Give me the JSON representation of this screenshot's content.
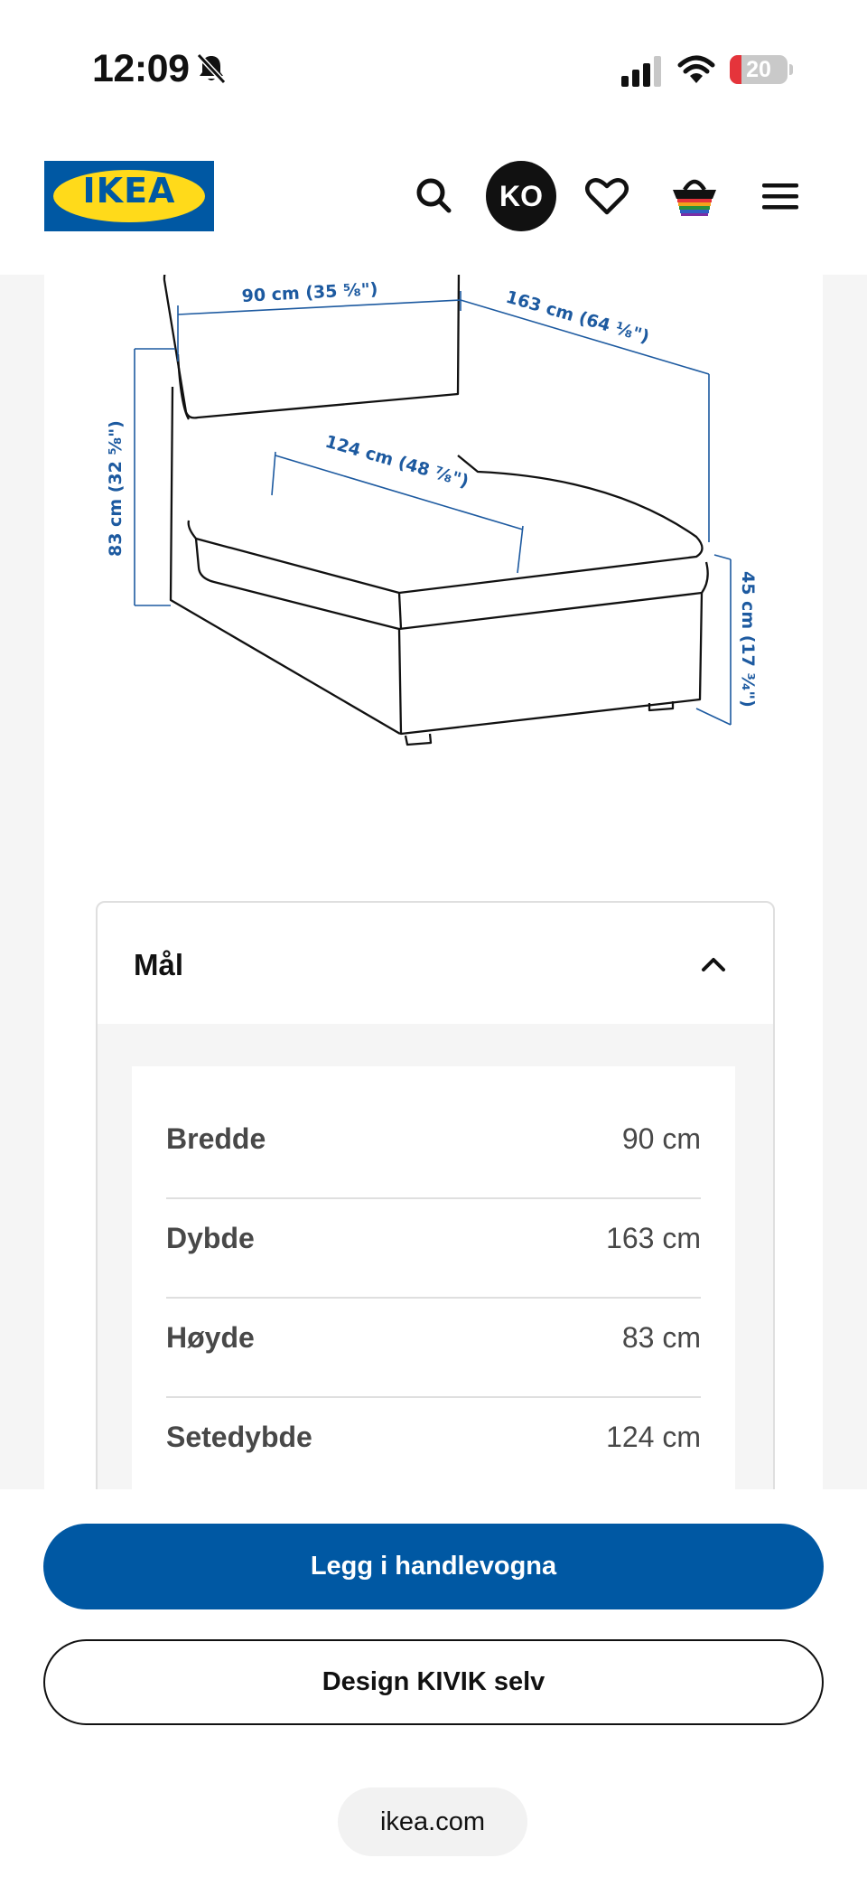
{
  "status_bar": {
    "time": "12:09",
    "battery_level": "20",
    "battery_fraction": 0.2,
    "battery_color": "#e5343b"
  },
  "header": {
    "logo_text": "IKEA",
    "logo_colors": {
      "blue": "#0058a3",
      "yellow": "#ffda1a"
    },
    "avatar_initials": "KO",
    "icons": [
      "search-icon",
      "heart-icon",
      "shopping-basket-icon",
      "hamburger-menu-icon"
    ]
  },
  "diagram": {
    "width_label": "90 cm (35 ⁵⁄₈\")",
    "depth_label": "163 cm (64 ¹⁄₈\")",
    "height_label": "83 cm (32 ⁵⁄₈\")",
    "seat_depth_label": "124 cm (48 ⁷⁄₈\")",
    "seat_height_label": "45 cm (17 ³⁄₄\")",
    "label_color": "#1d5aa0"
  },
  "dimensions": {
    "title": "Mål",
    "rows": [
      {
        "label": "Bredde",
        "value": "90 cm"
      },
      {
        "label": "Dybde",
        "value": "163 cm"
      },
      {
        "label": "Høyde",
        "value": "83 cm"
      },
      {
        "label": "Setedybde",
        "value": "124 cm"
      }
    ]
  },
  "actions": {
    "add_to_cart": "Legg i handlevogna",
    "design": "Design KIVIK selv"
  },
  "browser": {
    "url": "ikea.com"
  }
}
